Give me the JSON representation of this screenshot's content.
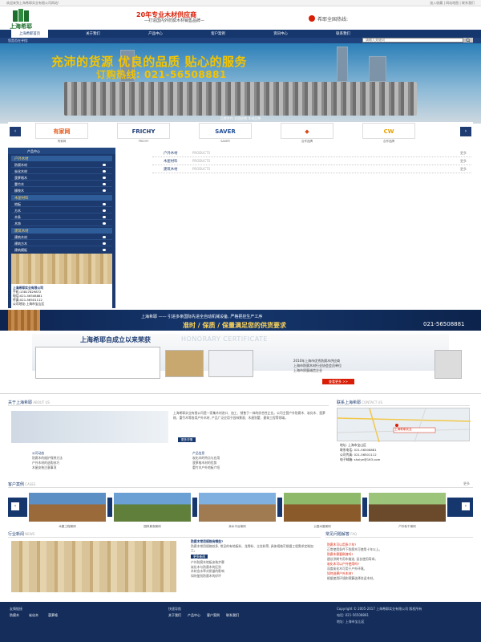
{
  "topbar": {
    "left": "欢迎来到上海希耶实业有限公司网站!",
    "right": "加入收藏 | 网站地图 | 联系我们"
  },
  "header": {
    "logo": "上海希耶",
    "slogan": "20年专业木材供应商",
    "subslogan": "—打造国内外防腐木材销售品牌—",
    "tel_label": "希耶全国热线:",
    "colors": {
      "brand": "#16376e",
      "accent": "#d81e06",
      "logo": "#1e6e2e"
    }
  },
  "nav": {
    "items": [
      "上海希耶首页",
      "关于我们",
      "产品中心",
      "客户案例",
      "资讯中心",
      "联系我们"
    ]
  },
  "subbar": {
    "text": "您是否在寻找:",
    "search_placeholder": "请输入关键词",
    "search_icon": "search-icon"
  },
  "banner": {
    "line1": "充沛的货源 优良的品质 贴心的服务",
    "line2": "订购热线: 021-56508881"
  },
  "partners": {
    "title": "品牌合作 全国经销 木材品种",
    "items": [
      {
        "name": "有家网",
        "caption": "有家网",
        "color": "#e35a1a"
      },
      {
        "name": "FRICHY",
        "caption": "FRICHY",
        "color": "#1e3c72"
      },
      {
        "name": "SAVER",
        "caption": "SAVER",
        "color": "#1e4c94"
      },
      {
        "name": "◆",
        "caption": "合作品牌",
        "color": "#d84a1a"
      },
      {
        "name": "CW",
        "caption": "合作品牌",
        "color": "#e6a000"
      }
    ]
  },
  "sidebar": {
    "header": "产品中心",
    "groups": [
      {
        "title": "户外木材",
        "items": [
          "防腐木材",
          "炭化木材",
          "菠萝格木",
          "重竹木",
          "柳桉木"
        ]
      },
      {
        "title": "木屋材料",
        "items": [
          "地板",
          "方木",
          "木条",
          "木饰"
        ]
      },
      {
        "title": "建筑木材",
        "items": [
          "建筑木材",
          "建筑方木",
          "建筑模板"
        ]
      }
    ],
    "contact": [
      "上海希耶实业有限公司",
      "手机:13817829872",
      "电话:021-56508881",
      "传真:021-56501112",
      "公司地址:上海市宝山区"
    ]
  },
  "product_list": [
    {
      "name": "户外木材",
      "en": "PRODUCTS",
      "more": "更多"
    },
    {
      "name": "木屋材料",
      "en": "PRODUCTS",
      "more": "更多"
    },
    {
      "name": "建筑木材",
      "en": "PRODUCTS",
      "more": "更多"
    }
  ],
  "ribbon": {
    "line1": "上海希耶 —— 引进多条国际先进全自动机械设备, 严格把控生产工序",
    "line2": "准时 / 保质 / 保量满足您的供货要求",
    "tel": "021-56508881"
  },
  "honor": {
    "title": "上海希耶自成立以来荣获",
    "en": "HONORARY CERTIFICATE",
    "items": [
      "2010年上海市优秀防腐木供应商",
      "上海市防腐木材行业协会会员单位",
      "上海市质量诚信企业"
    ],
    "more": "查看更多 >>"
  },
  "about": {
    "title": "关于上海希耶",
    "en": "ABOUT US",
    "more_label": "更多详情",
    "text": "上海希耶实业有限公司是一家集木材进口、加工、销售于一体的综合性企业。公司主营户外防腐木、炭化木、菠萝格、重竹木等各类户外木材, 产品广泛应用于园林景观、木屋别墅、建筑工程等领域。"
  },
  "contact_box": {
    "title": "联系上海希耶",
    "en": "CONTACT US",
    "map_pin": "上海希耶实业",
    "lines": [
      "地址: 上海市宝山区",
      "联系电话: 021-56508881",
      "公司传真: 021-56501112",
      "电子邮箱: shxiye@163.com"
    ]
  },
  "news": {
    "company_title": "公司动态",
    "industry_title": "产品信息",
    "company_items": [
      "防腐木的维护保养方法",
      "户外木材的选购技巧",
      "木屋安装注意事项"
    ],
    "industry_items": [
      "炭化木的特点与应用",
      "菠萝格木材的优势",
      "重竹木户外地板介绍"
    ]
  },
  "cases": {
    "title": "客户案例",
    "en": "CASES",
    "more": "更多",
    "items": [
      {
        "caption": "木屋工程案例",
        "sky": "#5c8fc4",
        "wood": "#9b6a3a"
      },
      {
        "caption": "园林景观案例",
        "sky": "#6aa0d4",
        "wood": "#5f7f3a"
      },
      {
        "caption": "亲水平台案例",
        "sky": "#7fb0e0",
        "wood": "#a07a50"
      },
      {
        "caption": "公园木屋案例",
        "sky": "#8eb86a",
        "wood": "#8a5a2a"
      },
      {
        "caption": "户外秋千案例",
        "sky": "#9cc47a",
        "wood": "#6a4a2a"
      }
    ]
  },
  "industry": {
    "title": "行业新闻",
    "en": "NEWS",
    "headline": "防腐木常用规格有哪些?",
    "summary": "防腐木常用规格较多, 常见的有地板料、龙骨料、立柱料等, 具体规格可根据工程需求定制加工。",
    "more_label": "更多新闻",
    "items": [
      "户外防腐木地板安装步骤",
      "炭化木与防腐木的区别",
      "木材含水率对质量的影响",
      "如何鉴别防腐木的好坏"
    ]
  },
  "qa": {
    "title": "常见问题解答",
    "en": "FAQ",
    "items": [
      {
        "q": "防腐木可以用多少年?",
        "a": "正常使用条件下防腐木可使用十年以上。"
      },
      {
        "q": "防腐木需要刷漆吗?",
        "a": "建议涂刷专用木蜡油, 延长使用寿命。"
      },
      {
        "q": "炭化木可以户外使用吗?",
        "a": "深度炭化木可用于户外环境。"
      },
      {
        "q": "如何选择户外木材?",
        "a": "根据使用环境和预算选择合适木材。"
      }
    ]
  },
  "footer": {
    "col1_title": "友情链接",
    "col1_items": [
      "防腐木",
      "炭化木",
      "菠萝格"
    ],
    "col2_title": "快速导航",
    "col2_items": [
      "关于我们",
      "产品中心",
      "客户案例",
      "联系我们"
    ],
    "copyright": "Copyright © 2005-2017 上海希耶实业有限公司 版权所有",
    "tel": "电话: 021-56508881",
    "addr": "地址: 上海市宝山区"
  }
}
